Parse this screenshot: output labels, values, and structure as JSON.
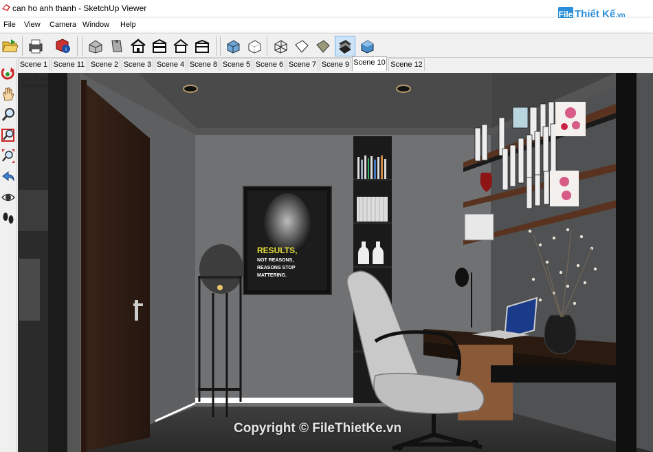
{
  "window": {
    "title": "can ho anh thanh - SketchUp Viewer"
  },
  "brand": {
    "logo": "File",
    "name": "Thiết Kế",
    "tld": ".vn"
  },
  "menu": [
    "File",
    "View",
    "Camera",
    "Window",
    "Help"
  ],
  "toolbar_icons": [
    "open-icon",
    "print-icon",
    "model-info-icon",
    "iso-view-icon",
    "top-view-icon",
    "front-view-icon",
    "right-view-icon",
    "back-view-icon",
    "left-view-icon",
    "xray-icon",
    "back-edges-icon",
    "wireframe-icon",
    "hidden-line-icon",
    "shaded-icon",
    "shaded-textures-icon",
    "monochrome-icon"
  ],
  "scenes": {
    "tabs": [
      "Scene 1",
      "Scene 11",
      "Scene 2",
      "Scene 3",
      "Scene 4",
      "Scene 8",
      "Scene 5",
      "Scene 6",
      "Scene 7",
      "Scene 9",
      "Scene 10",
      "Scene 12"
    ],
    "selected": "Scene 10"
  },
  "left_tools": [
    "orbit-icon",
    "pan-icon",
    "zoom-icon",
    "zoom-window-icon",
    "zoom-extents-icon",
    "previous-view-icon",
    "look-around-icon",
    "walk-icon"
  ],
  "viewport": {
    "camera_label_line1": "Two Point",
    "camera_label_line2": "Perspective"
  },
  "poster": {
    "line1": "RESULTS,",
    "line2": "NOT REASONS,",
    "line3": "REASONS STOP",
    "line4": "MATTERING."
  },
  "watermark": "Copyright © FileThietKe.vn",
  "colors": {
    "accent": "#2a8fd8",
    "selected_tool": "#cde3f8"
  }
}
